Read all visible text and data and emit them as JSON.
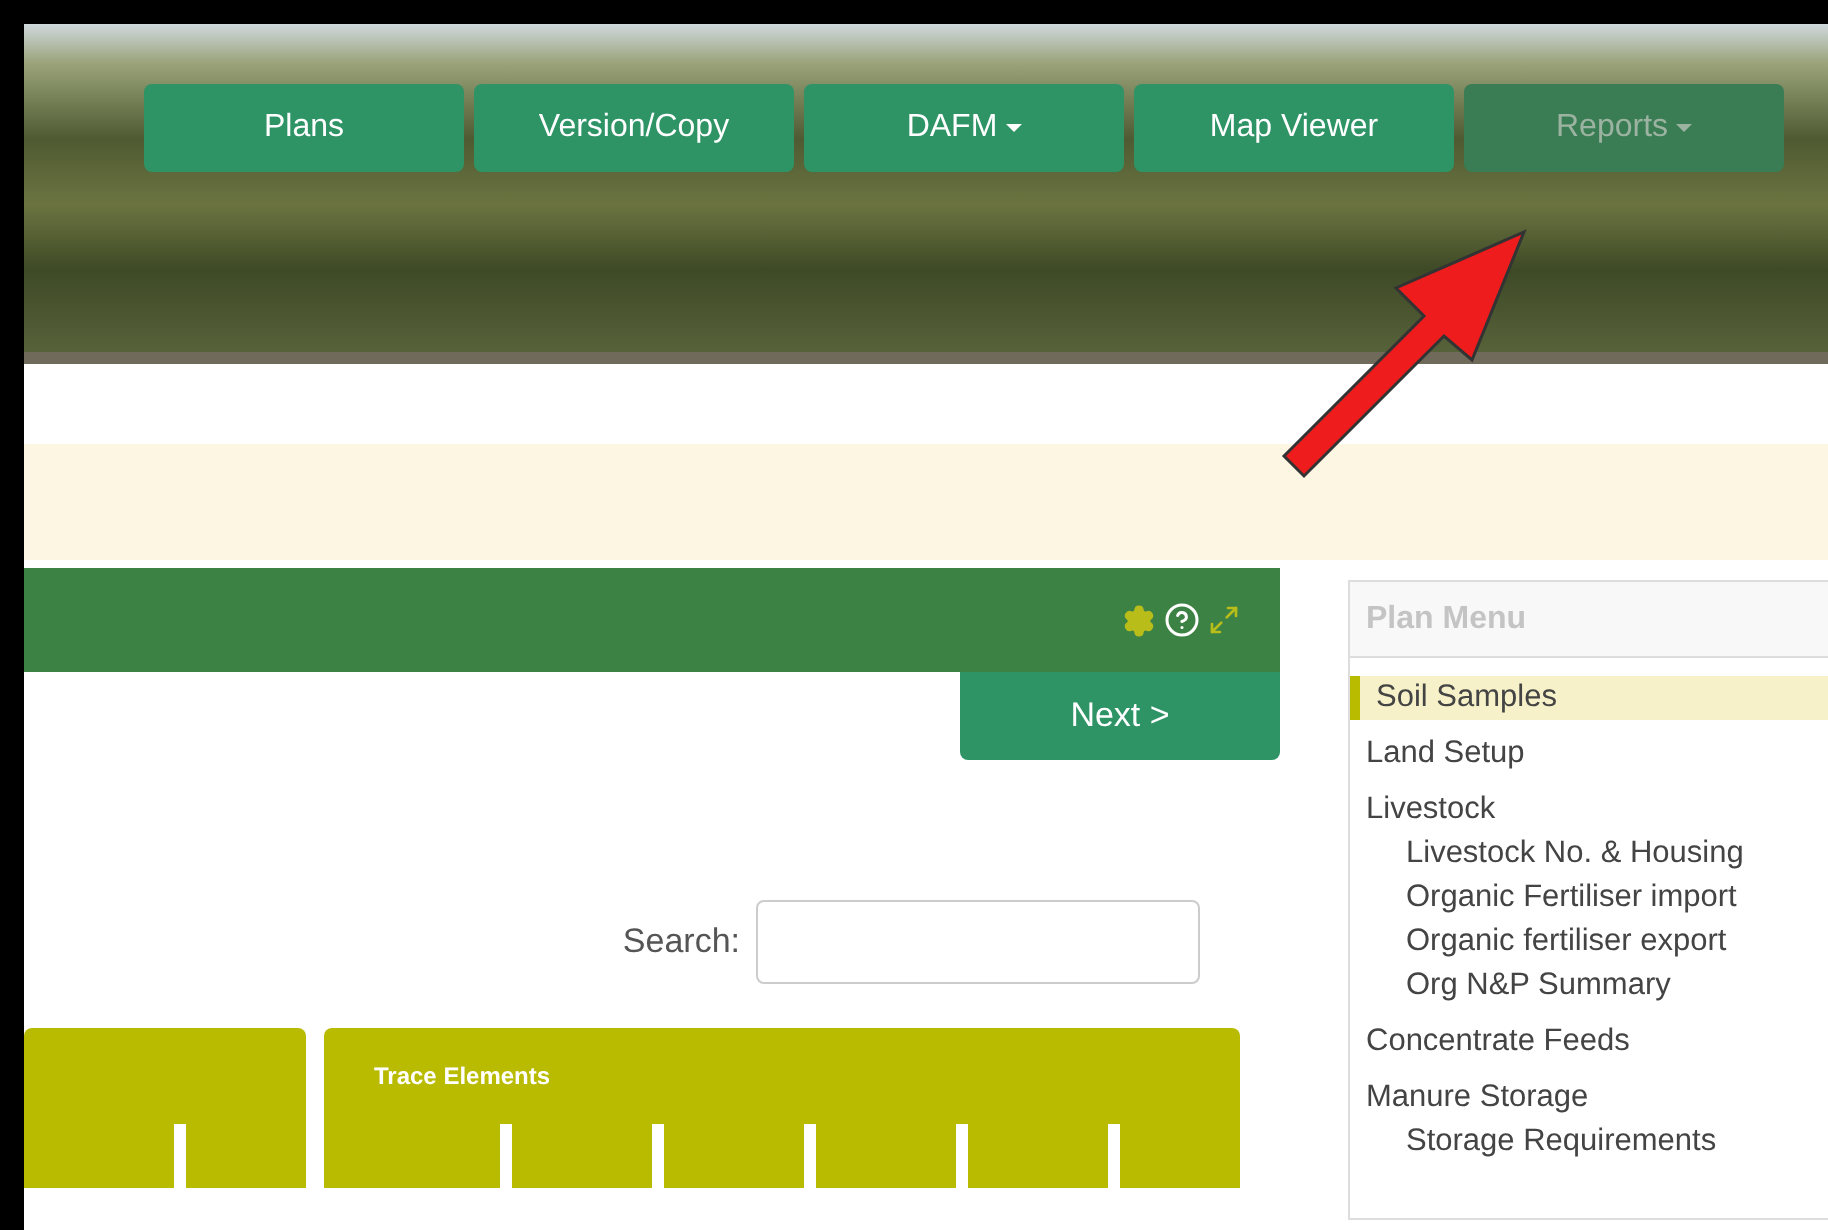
{
  "nav": [
    {
      "label": "Plans",
      "dropdown": false,
      "disabled": false
    },
    {
      "label": "Version/Copy",
      "dropdown": false,
      "disabled": false
    },
    {
      "label": "DAFM",
      "dropdown": true,
      "disabled": false
    },
    {
      "label": "Map Viewer",
      "dropdown": false,
      "disabled": false
    },
    {
      "label": "Reports",
      "dropdown": true,
      "disabled": true
    }
  ],
  "next_button": "Next >",
  "search": {
    "label": "Search:"
  },
  "table": {
    "column_groups": [
      {
        "kind": "narrow"
      },
      {
        "kind": "wide",
        "label": "Trace Elements"
      }
    ]
  },
  "plan_menu": {
    "title": "Plan Menu",
    "items": [
      {
        "label": "Soil Samples",
        "selected": true
      },
      {
        "label": "Land Setup",
        "selected": false
      },
      {
        "label": "Livestock",
        "selected": false,
        "children": [
          {
            "label": "Livestock No. & Housing",
            "selected": false
          },
          {
            "label": "Organic Fertiliser import",
            "selected": false
          },
          {
            "label": "Organic fertiliser export",
            "selected": false
          },
          {
            "label": "Org N&P Summary",
            "selected": false
          }
        ]
      },
      {
        "label": "Concentrate Feeds",
        "selected": false
      },
      {
        "label": "Manure Storage",
        "selected": false,
        "children": [
          {
            "label": "Storage Requirements",
            "selected": false
          }
        ]
      }
    ]
  }
}
